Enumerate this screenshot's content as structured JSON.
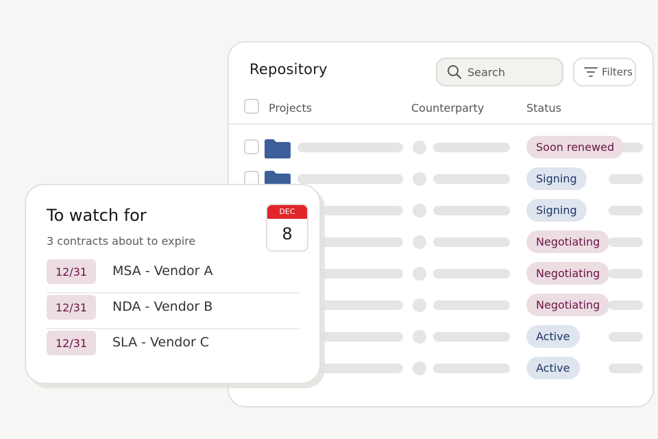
{
  "repository": {
    "title": "Repository",
    "search_placeholder": "Search",
    "filters_label": "Filters",
    "columns": [
      "Projects",
      "Counterparty",
      "Status"
    ],
    "rows": [
      {
        "status": "Soon renewed",
        "tone": "pink"
      },
      {
        "status": "Signing",
        "tone": "blue"
      },
      {
        "status": "Signing",
        "tone": "blue"
      },
      {
        "status": "Negotiating",
        "tone": "pink"
      },
      {
        "status": "Negotiating",
        "tone": "pink"
      },
      {
        "status": "Negotiating",
        "tone": "pink"
      },
      {
        "status": "Active",
        "tone": "blue"
      },
      {
        "status": "Active",
        "tone": "blue"
      }
    ]
  },
  "watch": {
    "title": "To watch for",
    "subtitle": "3 contracts about to expire",
    "calendar": {
      "month": "DEC",
      "day": "8"
    },
    "items": [
      {
        "date": "12/31",
        "name": "MSA - Vendor A"
      },
      {
        "date": "12/31",
        "name": "NDA - Vendor B"
      },
      {
        "date": "12/31",
        "name": "SLA - Vendor C"
      }
    ]
  },
  "colors": {
    "background": "#f7f6f4",
    "folder": "#3c5f99",
    "pink_pill_bg": "#ecdde3",
    "pink_pill_text": "#6a1443",
    "blue_pill_bg": "#dfe5ee",
    "blue_pill_text": "#1c3568",
    "calendar_red": "#e0262a"
  },
  "icons": [
    "search-icon",
    "filter-icon",
    "folder-icon",
    "calendar-icon"
  ]
}
